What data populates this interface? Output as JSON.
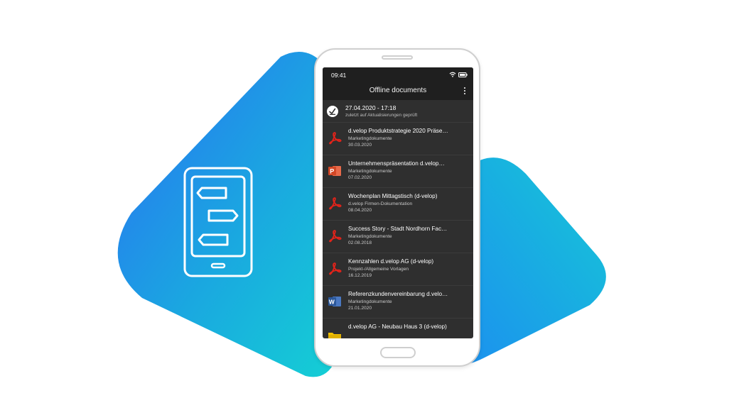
{
  "colors": {
    "gradient_top": "#2b7cf2",
    "gradient_bottom": "#18cbd6",
    "screen_bg": "#2f2f2f",
    "bar_bg": "#1f1f1f",
    "pdf_red": "#e2231a",
    "ppt_orange": "#d24726",
    "word_blue": "#2b579a",
    "folder_yellow": "#f3c200"
  },
  "status_bar": {
    "time": "09:41"
  },
  "app_bar": {
    "title": "Offline documents",
    "menu_icon": "more-vertical-icon"
  },
  "sync": {
    "icon": "checkmark-circle-icon",
    "date": "27.04.2020 - 17:18",
    "subtitle": "zuletzt auf Aktualisierungen geprüft"
  },
  "documents": [
    {
      "type": "pdf",
      "icon": "pdf-icon",
      "title": "d.velop Produktstrategie 2020 Präse…",
      "folder": "Marketingdokumente",
      "date": "30.03.2020"
    },
    {
      "type": "ppt",
      "icon": "powerpoint-icon",
      "title": "Unternehmenspräsentation d.velop…",
      "folder": "Marketingdokumente",
      "date": "07.02.2020"
    },
    {
      "type": "pdf",
      "icon": "pdf-icon",
      "title": "Wochenplan Mittagstisch (d-velop)",
      "folder": "d.velop Firmen-Dokumentation",
      "date": "08.04.2020"
    },
    {
      "type": "pdf",
      "icon": "pdf-icon",
      "title": "Success Story - Stadt Nordhorn Fac…",
      "folder": "Marketingdokumente",
      "date": "02.08.2018"
    },
    {
      "type": "pdf",
      "icon": "pdf-icon",
      "title": "Kennzahlen d.velop AG (d-velop)",
      "folder": "Projekt-/Allgemeine Vorlagen",
      "date": "16.12.2019"
    },
    {
      "type": "word",
      "icon": "word-icon",
      "title": "Referenzkundenvereinbarung d.velo…",
      "folder": "Marketingdokumente",
      "date": "21.01.2020"
    },
    {
      "type": "folder",
      "icon": "folder-icon",
      "title": "d.velop AG - Neubau Haus 3 (d-velop)",
      "folder": "",
      "date": ""
    }
  ]
}
